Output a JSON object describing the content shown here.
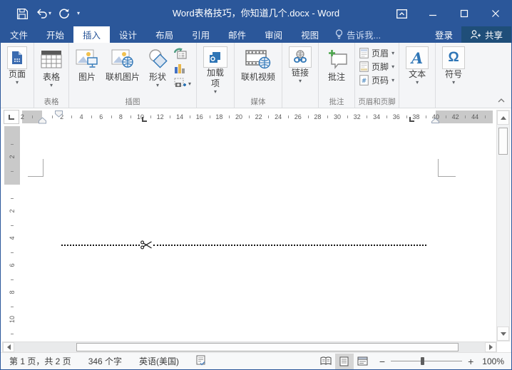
{
  "window": {
    "title": "Word表格技巧，你知道几个.docx - Word"
  },
  "icons": {
    "dropdown": "▾",
    "qat_more": "▾"
  },
  "tabs": [
    {
      "label": "文件"
    },
    {
      "label": "开始"
    },
    {
      "label": "插入",
      "active": true
    },
    {
      "label": "设计"
    },
    {
      "label": "布局"
    },
    {
      "label": "引用"
    },
    {
      "label": "邮件"
    },
    {
      "label": "审阅"
    },
    {
      "label": "视图"
    }
  ],
  "tellme": {
    "label": "告诉我..."
  },
  "account": {
    "sign_in": "登录",
    "share": "共享"
  },
  "ribbon": {
    "groups": [
      {
        "name": "pages",
        "label": "",
        "buttons": [
          {
            "label": "页面",
            "dropdown": true
          }
        ]
      },
      {
        "name": "tables",
        "label": "表格",
        "buttons": [
          {
            "label": "表格",
            "dropdown": true
          }
        ]
      },
      {
        "name": "illustrations",
        "label": "插图",
        "buttons": [
          {
            "label": "图片"
          },
          {
            "label": "联机图片"
          },
          {
            "label": "形状",
            "dropdown": true
          }
        ],
        "small_icons": [
          "smartart-icon",
          "chart-icon",
          "screenshot-icon"
        ]
      },
      {
        "name": "add-ins",
        "label": "",
        "buttons": [
          {
            "label": "加载项",
            "dropdown": true
          }
        ]
      },
      {
        "name": "media",
        "label": "媒体",
        "buttons": [
          {
            "label": "联机视频"
          }
        ]
      },
      {
        "name": "links",
        "label": "",
        "buttons": [
          {
            "label": "链接",
            "dropdown": true
          }
        ]
      },
      {
        "name": "comments",
        "label": "批注",
        "buttons": [
          {
            "label": "批注"
          }
        ]
      },
      {
        "name": "header-footer",
        "label": "页眉和页脚",
        "rows": [
          {
            "label": "页眉",
            "dropdown": true
          },
          {
            "label": "页脚",
            "dropdown": true
          },
          {
            "label": "页码",
            "dropdown": true
          }
        ]
      },
      {
        "name": "text",
        "label": "",
        "buttons": [
          {
            "label": "文本",
            "dropdown": true,
            "icon_glyph": "A"
          }
        ]
      },
      {
        "name": "symbols",
        "label": "",
        "buttons": [
          {
            "label": "符号",
            "dropdown": true,
            "icon_glyph": "Ω"
          }
        ]
      }
    ]
  },
  "ruler": {
    "h_margin_left_numbers": [
      "2"
    ],
    "h_numbers": [
      "2",
      "4",
      "6",
      "8",
      "10",
      "12",
      "14",
      "16",
      "18",
      "20",
      "22",
      "24",
      "26",
      "28",
      "30",
      "32",
      "34",
      "36",
      "38"
    ],
    "h_margin_right_numbers": [
      "40",
      "42",
      "44"
    ],
    "v_margin_numbers": [
      "2"
    ],
    "v_numbers": [
      "2",
      "4",
      "6",
      "8",
      "10"
    ]
  },
  "status_bar": {
    "page": "第 1 页，共 2 页",
    "words": "346 个字",
    "language": "英语(美国)",
    "zoom_level": "100%"
  },
  "colors": {
    "titlebar": "#2b579a",
    "share_button": "#1f4e79",
    "ribbon_bg": "#f4f5f7",
    "accent_blue": "#2e75b6"
  }
}
